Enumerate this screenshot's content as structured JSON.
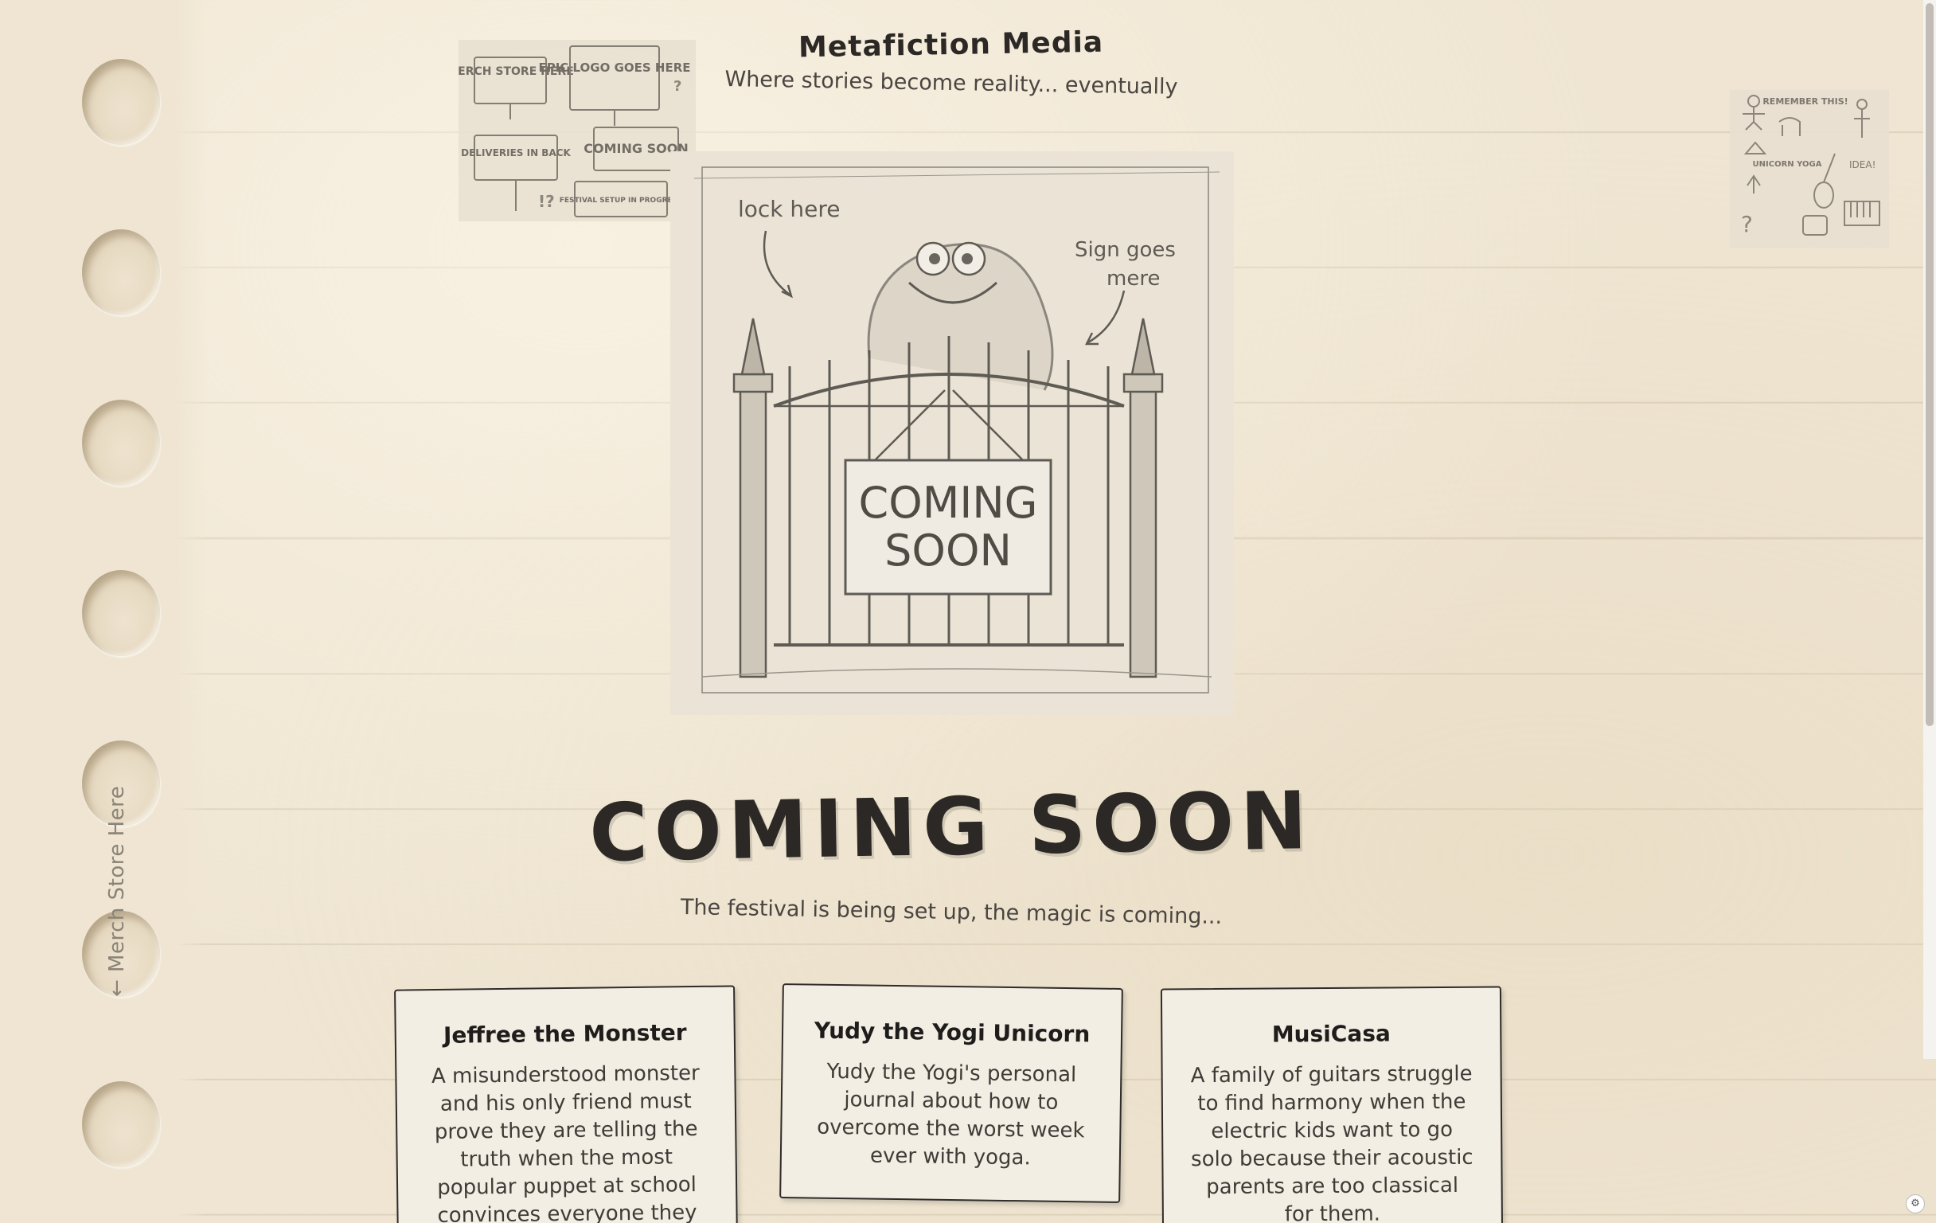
{
  "header": {
    "brand": "Metafiction Media",
    "tagline": "Where stories become reality... eventually"
  },
  "side_link": {
    "label": "← Merch Store Here"
  },
  "sign_sketch": {
    "signs": [
      "MERCH STORE HERE",
      "EPIC LOGO GOES HERE",
      "DELIVERIES IN BACK",
      "COMING SOON",
      "FESTIVAL SETUP IN PROGRESS"
    ]
  },
  "main_sketch": {
    "note_left": "lock here",
    "note_right_1": "Sign goes",
    "note_right_2": "mere",
    "gate_sign_1": "COMING",
    "gate_sign_2": "SOON"
  },
  "yoga_sketch": {
    "notes": [
      "REMEMBER THIS!",
      "UNICORN YOGA",
      "IDEA!"
    ]
  },
  "hero": {
    "title": "COMING SOON",
    "subtitle": "The festival is being set up, the magic is coming..."
  },
  "cards": [
    {
      "title": "Jeffree the Monster",
      "body": "A misunderstood monster and his only friend must prove they are telling the truth when the most popular puppet at school convinces everyone they cheated."
    },
    {
      "title": "Yudy the Yogi Unicorn",
      "body": "Yudy the Yogi's personal journal about how to overcome the worst week ever with yoga."
    },
    {
      "title": "MusiCasa",
      "body": "A family of guitars struggle to find harmony when the electric kids want to go solo because their acoustic parents are too classical for them."
    }
  ]
}
